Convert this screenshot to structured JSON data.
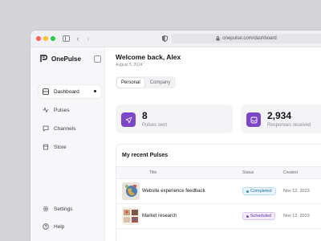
{
  "browser": {
    "url": "onepulse.com/dashboard"
  },
  "sidebar": {
    "brand": "OnePulse",
    "items": [
      {
        "label": "Dashboard",
        "icon": "grid-icon",
        "active": true
      },
      {
        "label": "Pulses",
        "icon": "activity-icon"
      },
      {
        "label": "Channels",
        "icon": "chat-icon"
      },
      {
        "label": "Store",
        "icon": "store-icon"
      },
      {
        "label": "Settings",
        "icon": "gear-icon"
      },
      {
        "label": "Help",
        "icon": "help-icon"
      }
    ]
  },
  "header": {
    "welcome": "Welcome back, Alex",
    "date": "August 5, 2024"
  },
  "tabs": [
    "Personal",
    "Company"
  ],
  "stats": [
    {
      "value": "8",
      "label": "Pulses sent",
      "icon": "send-icon"
    },
    {
      "value": "2,934",
      "label": "Responses received",
      "icon": "inbox-icon"
    }
  ],
  "recent": {
    "title": "My recent Pulses",
    "columns": [
      "Title",
      "Status",
      "Created"
    ],
    "rows": [
      {
        "title": "Website experience feedback",
        "status": "Completed",
        "created": "Nov 12, 2023"
      },
      {
        "title": "Market research",
        "status": "Scheduled",
        "created": "Nov 12, 2023"
      }
    ]
  },
  "colors": {
    "accent": "#7c46c8",
    "completed": "#2a8fd6",
    "scheduled": "#7c46c8"
  }
}
